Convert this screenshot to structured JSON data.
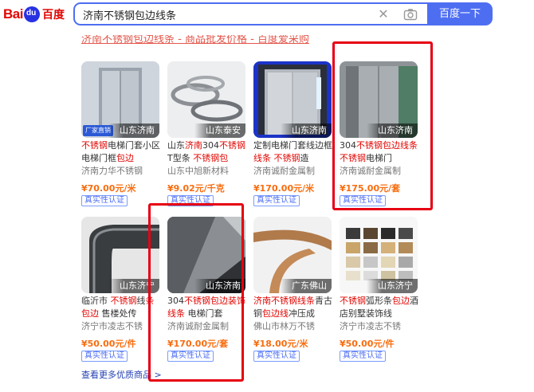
{
  "header": {
    "logo_text_left": "Bai",
    "logo_text_right": "du",
    "logo_text_cn": "百度",
    "search_value": "济南不锈钢包边线条",
    "search_button": "百度一下",
    "clear_icon": "close-icon",
    "camera_icon": "camera-icon"
  },
  "result": {
    "title": "济南不锈钢包边线条 - 商品批发价格 - 百度爱采购"
  },
  "products": [
    {
      "location": "山东济南",
      "badge": "厂家直销",
      "title_parts": [
        {
          "t": "不锈钢",
          "h": true
        },
        {
          "t": "电梯门套小区电梯门框",
          "h": false
        },
        {
          "t": "包边",
          "h": true
        }
      ],
      "seller": "济南力华不锈钢",
      "price": "¥70.00元/米",
      "verify": "真实性认证"
    },
    {
      "location": "山东泰安",
      "badge": "",
      "title_parts": [
        {
          "t": "山东",
          "h": false
        },
        {
          "t": "济南",
          "h": true
        },
        {
          "t": "304",
          "h": false
        },
        {
          "t": "不锈钢",
          "h": true
        },
        {
          "t": "T型条 ",
          "h": false
        },
        {
          "t": "不锈钢包",
          "h": true
        }
      ],
      "seller": "山东中旭新材料",
      "price": "¥9.02元/千克",
      "verify": "真实性认证"
    },
    {
      "location": "山东济南",
      "badge": "",
      "title_parts": [
        {
          "t": "定制电梯门套线边框",
          "h": false
        },
        {
          "t": "线条",
          "h": true
        },
        {
          "t": " ",
          "h": false
        },
        {
          "t": "不锈钢",
          "h": true
        },
        {
          "t": "造",
          "h": false
        }
      ],
      "seller": "济南诚耐金属制",
      "price": "¥170.00元/米",
      "verify": "真实性认证"
    },
    {
      "location": "山东济南",
      "badge": "",
      "title_parts": [
        {
          "t": "304",
          "h": false
        },
        {
          "t": "不锈钢包边线条",
          "h": true
        },
        {
          "t": " ",
          "h": false
        },
        {
          "t": "不锈钢",
          "h": true
        },
        {
          "t": "电梯门",
          "h": false
        }
      ],
      "seller": "济南诚耐金属制",
      "price": "¥175.00元/套",
      "verify": "真实性认证"
    },
    {
      "location": "山东济宁",
      "badge": "",
      "title_parts": [
        {
          "t": "临沂市 ",
          "h": false
        },
        {
          "t": "不锈钢",
          "h": true
        },
        {
          "t": "线",
          "h": false
        },
        {
          "t": "条包边",
          "h": true
        },
        {
          "t": " 售楼处传",
          "h": false
        }
      ],
      "seller": "济宁市凌志不锈",
      "price": "¥50.00元/件",
      "verify": "真实性认证"
    },
    {
      "location": "山东济南",
      "badge": "",
      "title_parts": [
        {
          "t": "304",
          "h": false
        },
        {
          "t": "不锈钢包边装",
          "h": true
        },
        {
          "t": "饰线条",
          "h": true
        },
        {
          "t": " 电梯门套",
          "h": false
        }
      ],
      "seller": "济南诚耐金属制",
      "price": "¥170.00元/套",
      "verify": "真实性认证"
    },
    {
      "location": "广东佛山",
      "badge": "",
      "title_parts": [
        {
          "t": "济南不锈钢线条",
          "h": true
        },
        {
          "t": "青古铜",
          "h": false
        },
        {
          "t": "包边线",
          "h": true
        },
        {
          "t": "冲压成",
          "h": false
        }
      ],
      "seller": "佛山市林万不锈",
      "price": "¥18.00元/米",
      "verify": "真实性认证"
    },
    {
      "location": "山东济宁",
      "badge": "",
      "title_parts": [
        {
          "t": "不锈钢",
          "h": true
        },
        {
          "t": "弧形条",
          "h": false
        },
        {
          "t": "包边",
          "h": true
        },
        {
          "t": "酒店别墅装饰线",
          "h": false
        }
      ],
      "seller": "济宁市凌志不锈",
      "price": "¥50.00元/件",
      "verify": "真实性认证"
    }
  ],
  "footer": {
    "more_link": "查看更多优质商品 >"
  },
  "colors": {
    "accent": "#4e6ef2",
    "highlight": "#e10602",
    "price": "#f86d0f",
    "annotation_box": "#e60012"
  }
}
